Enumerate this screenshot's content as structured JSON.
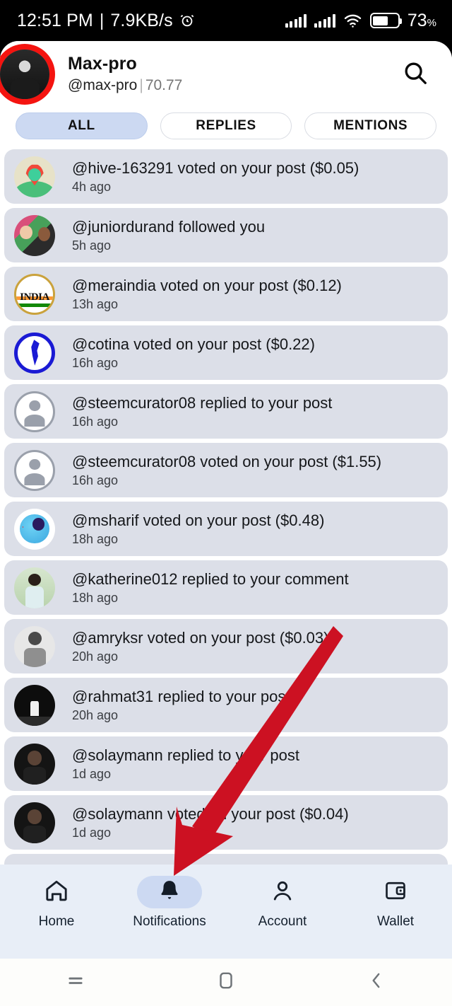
{
  "status_bar": {
    "time": "12:51 PM",
    "separator": "|",
    "network_speed": "7.9KB/s",
    "alarm_icon": "alarm-icon",
    "signal_icon": "signal-bars-icon",
    "wifi_icon": "wifi-icon",
    "battery_icon": "battery-icon",
    "battery_percent": "73",
    "battery_percent_symbol": "%"
  },
  "header": {
    "avatar": "user-avatar",
    "display_name": "Max-pro",
    "handle": "@max-pro",
    "divider": "|",
    "reputation": "70.77",
    "search_icon": "search-icon"
  },
  "filter_tabs": [
    {
      "label": "ALL",
      "active": true
    },
    {
      "label": "REPLIES",
      "active": false
    },
    {
      "label": "MENTIONS",
      "active": false
    }
  ],
  "notifications": [
    {
      "text": "@hive-163291 voted on your post ($0.05)",
      "time": "4h ago",
      "avatar": "location-pin-avatar"
    },
    {
      "text": "@juniordurand followed you",
      "time": "5h ago",
      "avatar": "couple-photo-avatar"
    },
    {
      "text": "@meraindia voted on your post ($0.12)",
      "time": "13h ago",
      "avatar": "india-emblem-avatar"
    },
    {
      "text": "@cotina voted on your post ($0.22)",
      "time": "16h ago",
      "avatar": "south-america-map-avatar"
    },
    {
      "text": "@steemcurator08 replied to your post",
      "time": "16h ago",
      "avatar": "anonymous-person-avatar"
    },
    {
      "text": "@steemcurator08 voted on your post ($1.55)",
      "time": "16h ago",
      "avatar": "anonymous-person-avatar"
    },
    {
      "text": "@msharif voted on your post ($0.48)",
      "time": "18h ago",
      "avatar": "astronaut-avatar"
    },
    {
      "text": "@katherine012 replied to your comment",
      "time": "18h ago",
      "avatar": "woman-photo-avatar"
    },
    {
      "text": "@amryksr voted on your post ($0.03)",
      "time": "20h ago",
      "avatar": "bw-portrait-avatar"
    },
    {
      "text": "@rahmat31 replied to your post",
      "time": "20h ago",
      "avatar": "stage-photo-avatar"
    },
    {
      "text": "@solaymann replied to your post",
      "time": "1d ago",
      "avatar": "bearded-man-avatar"
    },
    {
      "text": "@solaymann voted on your post ($0.04)",
      "time": "1d ago",
      "avatar": "bearded-man-avatar"
    }
  ],
  "bottom_nav": [
    {
      "label": "Home",
      "icon": "home-icon",
      "active": false
    },
    {
      "label": "Notifications",
      "icon": "bell-icon",
      "active": true
    },
    {
      "label": "Account",
      "icon": "person-icon",
      "active": false
    },
    {
      "label": "Wallet",
      "icon": "wallet-icon",
      "active": false
    }
  ],
  "system_nav": [
    {
      "icon": "recents-icon"
    },
    {
      "icon": "home-square-icon"
    },
    {
      "icon": "back-chevron-icon"
    }
  ],
  "annotation": {
    "arrow": "red-arrow-pointing-to-notifications",
    "color": "#cc1122"
  },
  "colors": {
    "accent_pill": "#ccd9f2",
    "list_item_bg": "#dcdfe8",
    "bottom_nav_bg": "#e8eef7",
    "avatar_ring": "#f41410"
  }
}
